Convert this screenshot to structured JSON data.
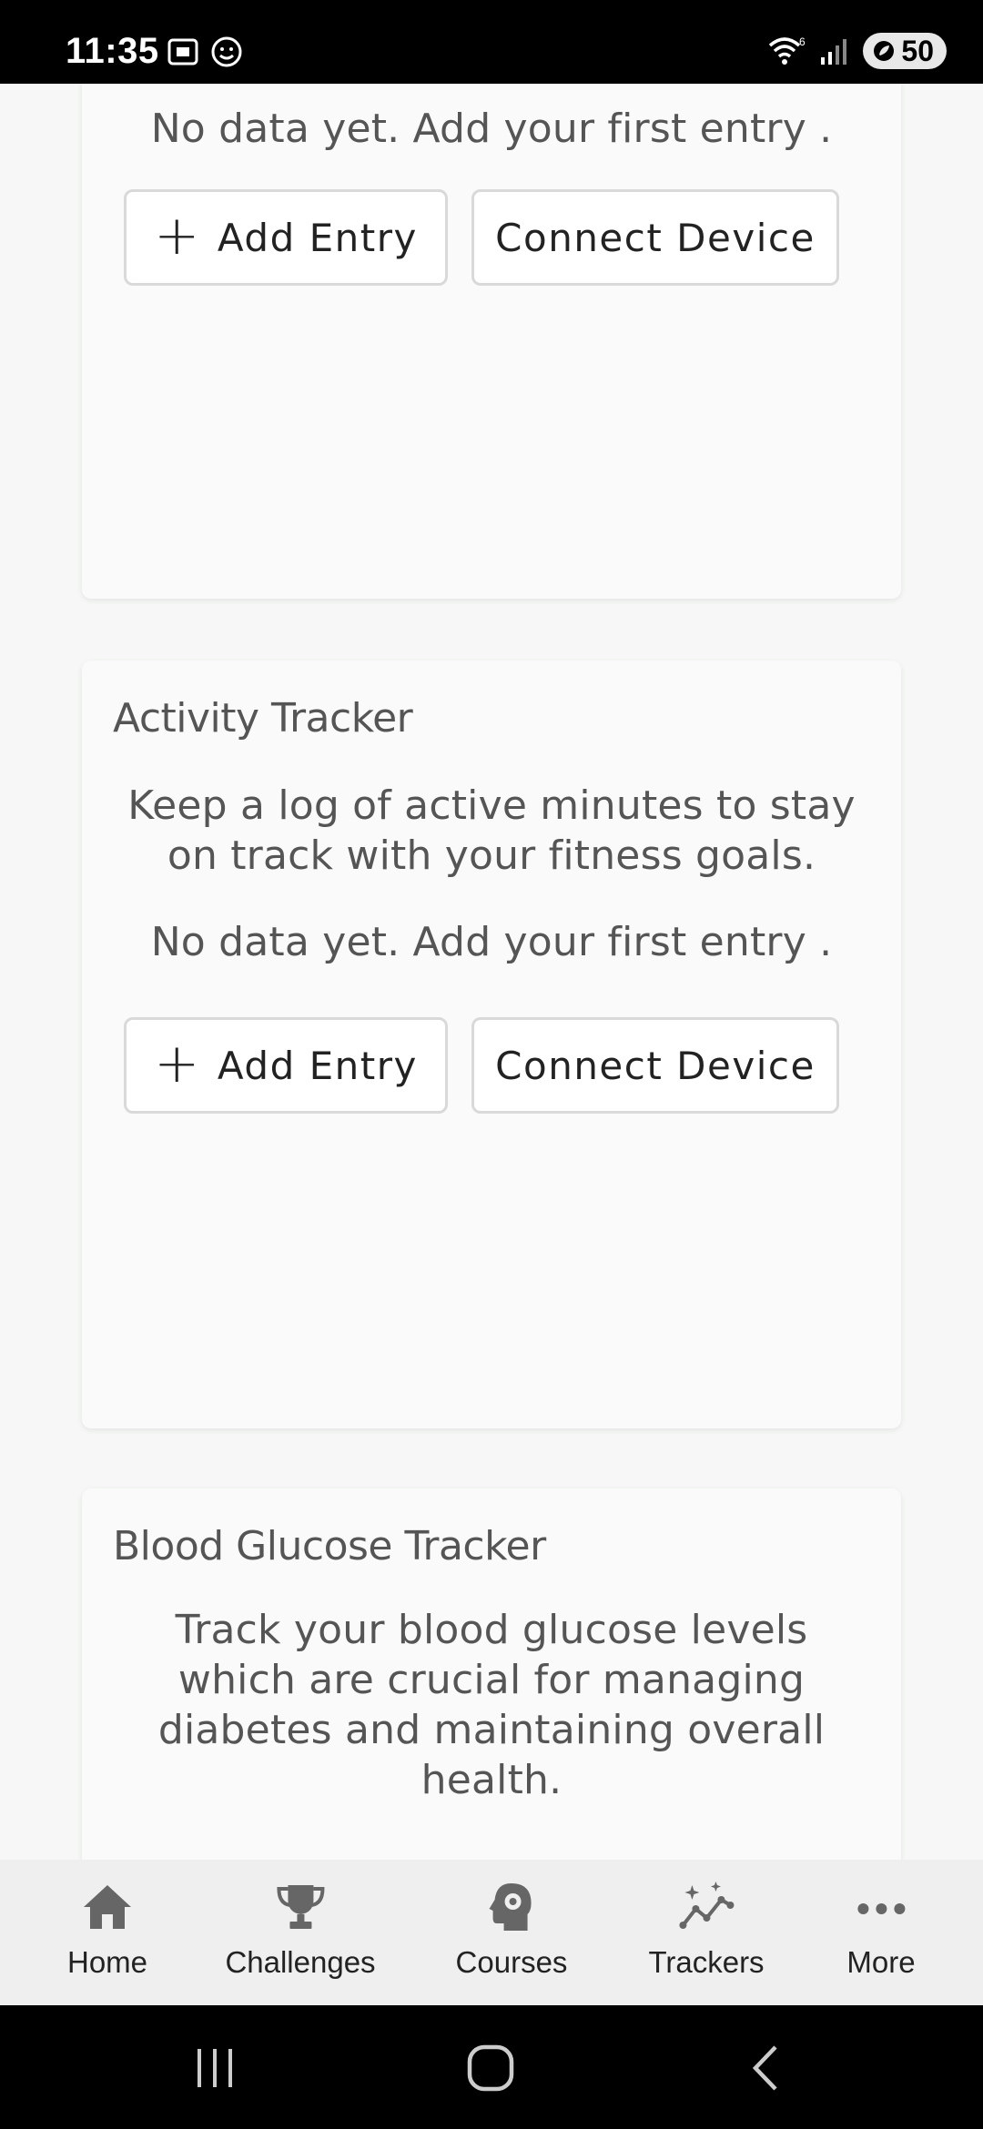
{
  "status": {
    "time": "11:35",
    "battery": "50"
  },
  "cards": [
    {
      "title": "",
      "description": "",
      "no_data": "No data yet. Add your first entry .",
      "add_label": "Add Entry",
      "connect_label": "Connect Device"
    },
    {
      "title": "Activity Tracker",
      "description": "Keep a log of active minutes to stay on track with your fitness goals.",
      "no_data": "No data yet. Add your first entry .",
      "add_label": "Add Entry",
      "connect_label": "Connect Device"
    },
    {
      "title": "Blood Glucose Tracker",
      "description": "Track your blood glucose levels which are crucial for managing diabetes and maintaining overall health."
    }
  ],
  "nav": {
    "home": "Home",
    "challenges": "Challenges",
    "courses": "Courses",
    "trackers": "Trackers",
    "more": "More"
  },
  "icons": {
    "home": "home-icon",
    "challenges": "trophy-icon",
    "courses": "brain-gear-icon",
    "trackers": "trend-sparkle-icon",
    "more": "more-dots-icon"
  },
  "colors": {
    "background": "#f6f7f6",
    "card": "#f9faf9",
    "nav_bar": "#efefef",
    "icon": "#666666"
  }
}
